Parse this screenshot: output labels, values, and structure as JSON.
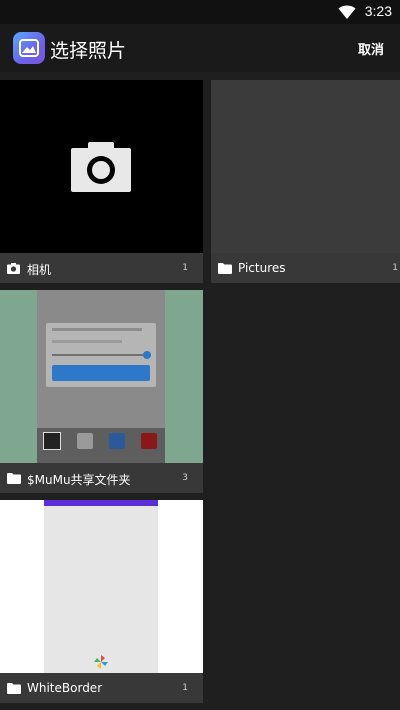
{
  "status_bar": {
    "time": "3:23"
  },
  "app_bar": {
    "title": "选择照片",
    "cancel_label": "取消"
  },
  "albums": [
    {
      "name": "相机",
      "count": "1",
      "icon": "camera-icon"
    },
    {
      "name": "Pictures",
      "count": "1",
      "icon": "folder-icon"
    },
    {
      "name": "$MuMu共享文件夹",
      "count": "3",
      "icon": "folder-icon"
    },
    {
      "name": "WhiteBorder",
      "count": "1",
      "icon": "folder-icon"
    }
  ],
  "colors": {
    "background": "#1f1f1f",
    "app_bar": "#1a1a1a",
    "caption_bg": "#3a3a3a",
    "accent": "#6b63e8"
  }
}
